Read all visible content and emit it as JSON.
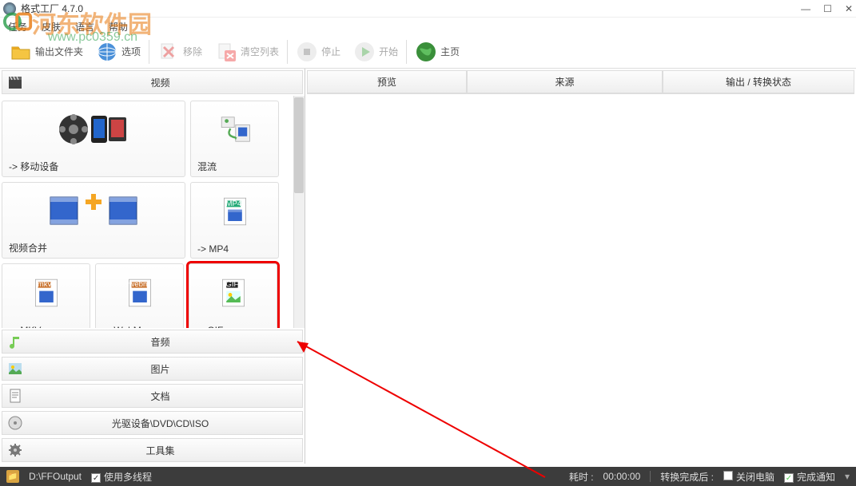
{
  "window": {
    "title": "格式工厂 4.7.0"
  },
  "menu": {
    "task": "任务",
    "skin": "皮肤",
    "lang": "语言",
    "help": "帮助"
  },
  "watermark": {
    "text": "河东软件园",
    "url": "www.pc0359.cn"
  },
  "toolbar": {
    "output": "输出文件夹",
    "options": "选项",
    "remove": "移除",
    "clear": "清空列表",
    "stop": "停止",
    "start": "开始",
    "home": "主页"
  },
  "categories": {
    "video": "视频",
    "audio": "音频",
    "picture": "图片",
    "document": "文档",
    "drive": "光驱设备\\DVD\\CD\\ISO",
    "tools": "工具集"
  },
  "tiles": {
    "mobile": "-> 移动设备",
    "mix": "混流",
    "merge": "视频合并",
    "mp4": "-> MP4",
    "mkv": "-> MKV",
    "webm": "-> WebM",
    "gif": "-> GIF"
  },
  "columns": {
    "preview": "预览",
    "source": "来源",
    "output": "输出 / 转换状态"
  },
  "status": {
    "path": "D:\\FFOutput",
    "mt": "使用多线程",
    "time_label": "耗时 :",
    "time_val": "00:00:00",
    "after_label": "转换完成后 :",
    "after_val": "关闭电脑",
    "notify": "完成通知"
  }
}
